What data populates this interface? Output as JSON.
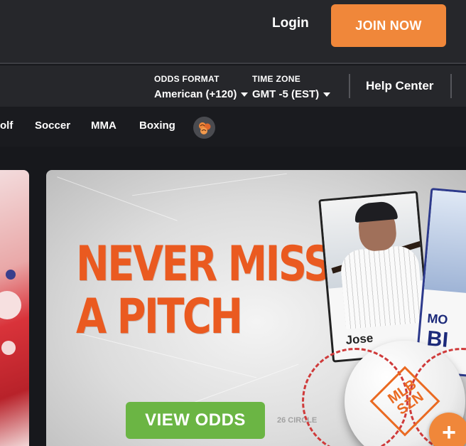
{
  "header": {
    "login_label": "Login",
    "join_label": "JOIN NOW"
  },
  "settings": {
    "odds_format_label": "ODDS FORMAT",
    "odds_format_value": "American (+120)",
    "time_zone_label": "TIME ZONE",
    "time_zone_value": "GMT -5 (EST)",
    "help_center_label": "Help Center"
  },
  "sports_nav": {
    "items": [
      {
        "label": "olf"
      },
      {
        "label": "Soccer"
      },
      {
        "label": "MMA"
      },
      {
        "label": "Boxing"
      }
    ],
    "more_icon": "multi-ball-icon"
  },
  "promo": {
    "headline_line1": "NEVER MISS",
    "headline_line2": "A PITCH",
    "cta_label": "VIEW ODDS",
    "card1_name": "Jose",
    "card2_name": "MO",
    "card2_name2": "BI",
    "ball_badge_line1": "MLB",
    "ball_badge_line2": "SZN",
    "field_text": "26 CIRCLE"
  },
  "floating_action": {
    "label": "+"
  },
  "colors": {
    "accent_orange": "#f0873a",
    "cta_green": "#6bb544",
    "headline_orange": "#ea5a20",
    "header_bg": "#26272b",
    "page_bg": "#17181c"
  }
}
